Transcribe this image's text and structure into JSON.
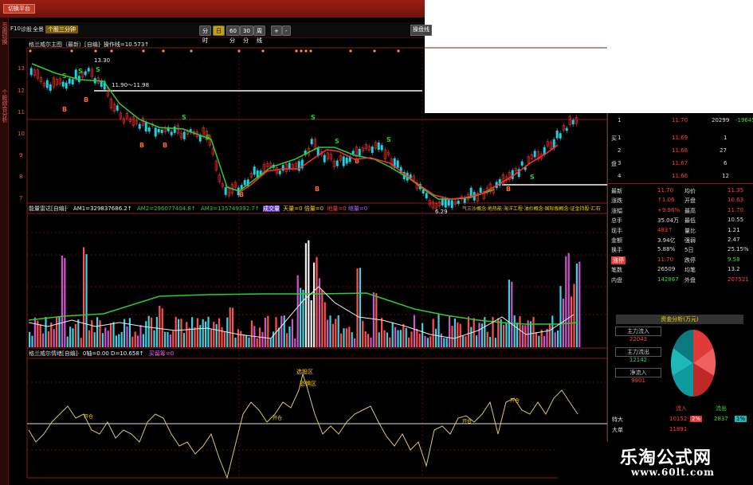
{
  "colors": {
    "up": "#ff4040",
    "down": "#3ddc3d",
    "accent": "#ffd400",
    "bg": "#000000"
  },
  "topbar": {
    "button": "切换平台"
  },
  "leftstrip": {
    "texts": [
      "页面切换",
      "个股综合分析"
    ]
  },
  "menubar": {
    "items": [
      "F10",
      "诊股",
      "全景",
      "个股三分钟"
    ],
    "active_index": 3
  },
  "periods": {
    "items": [
      "分时",
      "日线",
      "60分",
      "30分",
      "周线"
    ],
    "selected_index": 1,
    "plus": "+",
    "minus": "-",
    "right_button": "操盘线"
  },
  "price_chart": {
    "title": "格兰威尔主图（最新）[自编]·",
    "line_label": "操作线=10.573↑",
    "yticks": [
      "13",
      "12",
      "11",
      "10",
      "9",
      "8",
      "7"
    ],
    "annotations": {
      "high": "13.30",
      "range": "11.90～11.98",
      "low": "6.29"
    },
    "signals": {
      "buy": "B",
      "sell": "S"
    }
  },
  "volume_chart": {
    "title": "能量雷达[自编]·",
    "am1": "AM1=329837686.2↑",
    "am2": "AM2=296077404.8↑",
    "am3": "AM3=135749392.7↑",
    "vol_label": "成交量",
    "tianliang": "天量=0",
    "beiliang": "倍量=0",
    "quliang": "地量=0",
    "suoliang": "缩量=0",
    "concept": "气三沙概念·地热能·海洋工程·油价概念·国际板概念·证金持股·汇石"
  },
  "osc_chart": {
    "title": "格兰威尔情绪[自编]·",
    "values": "0轴=0.00  D=10.658↑",
    "extra": "买留筹=0",
    "zone_labels": {
      "greedy": "选股区",
      "fear": "恐惧区",
      "ps": "开仓"
    }
  },
  "quote": {
    "sell": [
      {
        "label": "卖",
        "level": "5",
        "price": "",
        "vol": ""
      },
      {
        "label": "",
        "level": "4",
        "price": "",
        "vol": ""
      },
      {
        "label": "",
        "level": "3",
        "price": "",
        "vol": ""
      },
      {
        "label": "",
        "level": "2",
        "price": "",
        "vol": ""
      },
      {
        "label": "",
        "level": "1",
        "price": "11.70",
        "vol": "20299",
        "chg": "-19645"
      }
    ],
    "buy": [
      {
        "label": "买",
        "level": "1",
        "price": "11.69",
        "vol": "1"
      },
      {
        "label": "",
        "level": "2",
        "price": "11.68",
        "vol": "27"
      },
      {
        "label": "盘",
        "level": "3",
        "price": "11.67",
        "vol": "6"
      },
      {
        "label": "",
        "level": "4",
        "price": "11.66",
        "vol": "12"
      }
    ],
    "stats": [
      {
        "l1": "最新",
        "v1": "11.70",
        "l2": "均价",
        "v2": "11.35"
      },
      {
        "l1": "涨跌",
        "v1": "↑1.06",
        "l2": "开盘",
        "v2": "10.63"
      },
      {
        "l1": "涨幅",
        "v1": "+9.96%",
        "l2": "最高",
        "v2": "11.70"
      },
      {
        "l1": "总手",
        "v1": "35.04万",
        "l2": "最低",
        "v2": "10.55"
      },
      {
        "l1": "现手",
        "v1": "483↑",
        "l2": "量比",
        "v2": "1.21"
      },
      {
        "l1": "金额",
        "v1": "3.94亿",
        "l2": "强弱",
        "v2": "2.47"
      },
      {
        "l1": "换手",
        "v1": "5.88%",
        "l2": "5日",
        "v2": "25.15%"
      },
      {
        "l1": "涨停",
        "v1": "11.70",
        "l2": "跌停",
        "v2": "9.58"
      },
      {
        "l1": "笔数",
        "v1": "26509",
        "l2": "均笔",
        "v2": "13.2"
      },
      {
        "l1": "内盘",
        "v1": "142867",
        "l2": "外盘",
        "v2": "207521"
      }
    ]
  },
  "fund": {
    "title": "资金分析(万元)",
    "main_in_label": "主力流入",
    "main_in": "22043",
    "main_out_label": "主力流出",
    "main_out": "12142",
    "net_label": "净流入",
    "net": "9901",
    "flow_in": "流入",
    "flow_out": "流出",
    "special_label": "特大",
    "special_in": "10152",
    "special_in_pct": "2%",
    "special_out": "2837",
    "special_out_pct": "1%",
    "big_label": "大单",
    "big_in": "11891"
  },
  "watermark": {
    "cn": "乐淘公式网",
    "url": "www.60lt.com"
  }
}
